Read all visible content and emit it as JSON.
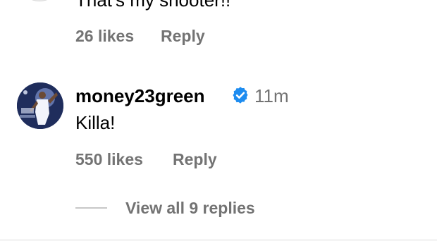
{
  "previous_comment": {
    "text": "That's my shooter!!",
    "likes_label": "26 likes",
    "reply_label": "Reply"
  },
  "comment": {
    "username": "money23green",
    "verified": true,
    "time": "11m",
    "text": "Killa!",
    "likes_label": "550 likes",
    "reply_label": "Reply",
    "view_replies_label": "View all 9 replies"
  },
  "colors": {
    "secondary_text": "#737373",
    "verified_badge": "#1d8cf0",
    "divider": "#c7c7c7"
  },
  "icons": {
    "verified": "verified-badge-icon"
  }
}
